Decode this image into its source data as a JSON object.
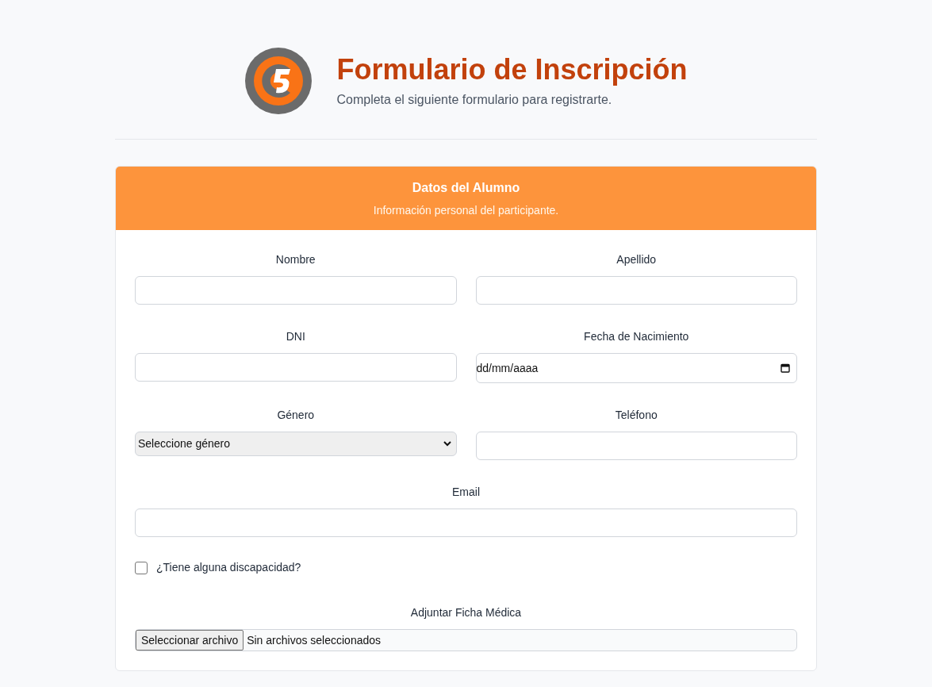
{
  "header": {
    "title": "Formulario de Inscripción",
    "subtitle": "Completa el siguiente formulario para registrarte."
  },
  "section": {
    "title": "Datos del Alumno",
    "subtitle": "Información personal del participante."
  },
  "rows": [
    [
      {
        "kind": "text",
        "label": "Nombre"
      },
      {
        "kind": "text",
        "label": "Apellido"
      }
    ],
    [
      {
        "kind": "text",
        "label": "DNI"
      },
      {
        "kind": "date",
        "label": "Fecha de Nacimiento",
        "placeholder": "dd/mm/aaaa"
      }
    ],
    [
      {
        "kind": "select",
        "label": "Género",
        "value": "Seleccione género"
      },
      {
        "kind": "text",
        "label": "Teléfono"
      }
    ],
    [
      {
        "kind": "text",
        "label": "Email"
      }
    ],
    [
      {
        "kind": "checkbox",
        "label": "¿Tiene alguna discapacidad?",
        "checked": false
      }
    ],
    [
      {
        "kind": "file",
        "label": "Adjuntar Ficha Médica",
        "button": "Seleccionar archivo",
        "status": "Sin archivos seleccionados"
      }
    ]
  ]
}
